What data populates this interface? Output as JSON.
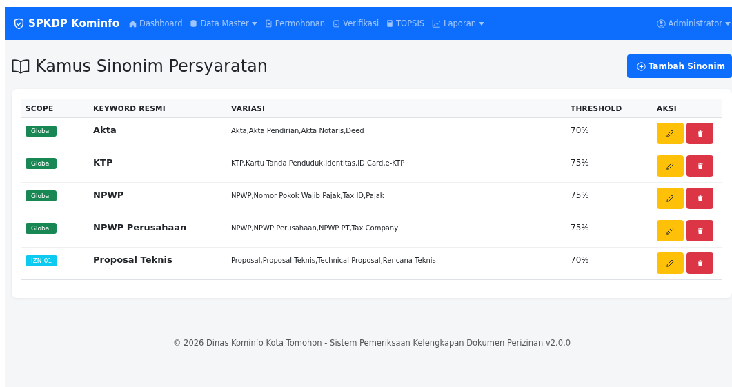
{
  "navbar": {
    "brand": "SPKDP Kominfo",
    "items": [
      {
        "label": "Dashboard",
        "dropdown": false
      },
      {
        "label": "Data Master",
        "dropdown": true
      },
      {
        "label": "Permohonan",
        "dropdown": false
      },
      {
        "label": "Verifikasi",
        "dropdown": false
      },
      {
        "label": "TOPSIS",
        "dropdown": false
      },
      {
        "label": "Laporan",
        "dropdown": true
      }
    ],
    "user": "Administrator"
  },
  "page": {
    "title": "Kamus Sinonim Persyaratan",
    "add_button": "Tambah Sinonim"
  },
  "table": {
    "columns": [
      "SCOPE",
      "KEYWORD RESMI",
      "VARIASI",
      "THRESHOLD",
      "AKSI"
    ],
    "rows": [
      {
        "scope": "Global",
        "color": "#198754",
        "keyword": "Akta",
        "variations": "Akta,Akta Pendirian,Akta Notaris,Deed",
        "threshold": "70%"
      },
      {
        "scope": "Global",
        "color": "#198754",
        "keyword": "KTP",
        "variations": "KTP,Kartu Tanda Penduduk,Identitas,ID Card,e-KTP",
        "threshold": "75%"
      },
      {
        "scope": "Global",
        "color": "#198754",
        "keyword": "NPWP",
        "variations": "NPWP,Nomor Pokok Wajib Pajak,Tax ID,Pajak",
        "threshold": "75%"
      },
      {
        "scope": "Global",
        "color": "#198754",
        "keyword": "NPWP Perusahaan",
        "variations": "NPWP,NPWP Perusahaan,NPWP PT,Tax Company",
        "threshold": "75%"
      },
      {
        "scope": "IZN-01",
        "color": "#0dcaf0",
        "keyword": "Proposal Teknis",
        "variations": "Proposal,Proposal Teknis,Technical Proposal,Rencana Teknis",
        "threshold": "70%"
      }
    ]
  },
  "footer": "© 2026 Dinas Kominfo Kota Tomohon - Sistem Pemeriksaan Kelengkapan Dokumen Perizinan v2.0.0"
}
